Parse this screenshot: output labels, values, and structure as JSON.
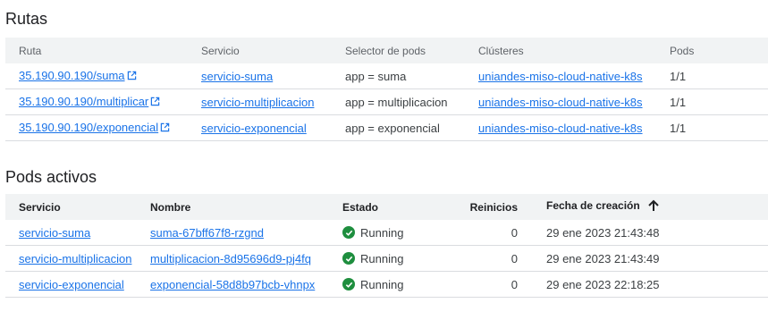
{
  "rutas": {
    "title": "Rutas",
    "headers": [
      "Ruta",
      "Servicio",
      "Selector de pods",
      "Clústeres",
      "Pods"
    ],
    "rows": [
      {
        "ruta": "35.190.90.190/suma",
        "servicio": "servicio-suma",
        "selector": "app = suma",
        "cluster": "uniandes-miso-cloud-native-k8s",
        "pods": "1/1"
      },
      {
        "ruta": "35.190.90.190/multiplicar",
        "servicio": "servicio-multiplicacion",
        "selector": "app = multiplicacion",
        "cluster": "uniandes-miso-cloud-native-k8s",
        "pods": "1/1"
      },
      {
        "ruta": "35.190.90.190/exponencial",
        "servicio": "servicio-exponencial",
        "selector": "app = exponencial",
        "cluster": "uniandes-miso-cloud-native-k8s",
        "pods": "1/1"
      }
    ]
  },
  "pods": {
    "title": "Pods activos",
    "headers": [
      "Servicio",
      "Nombre",
      "Estado",
      "Reinicios",
      "Fecha de creación"
    ],
    "sort_icon": "arrow-upward-icon",
    "rows": [
      {
        "servicio": "servicio-suma",
        "nombre": "suma-67bff67f8-rzgnd",
        "estado": "Running",
        "reinicios": "0",
        "fecha": "29 ene 2023 21:43:48"
      },
      {
        "servicio": "servicio-multiplicacion",
        "nombre": "multiplicacion-8d95696d9-pj4fq",
        "estado": "Running",
        "reinicios": "0",
        "fecha": "29 ene 2023 21:43:49"
      },
      {
        "servicio": "servicio-exponencial",
        "nombre": "exponencial-58d8b97bcb-vhnpx",
        "estado": "Running",
        "reinicios": "0",
        "fecha": "29 ene 2023 22:18:25"
      }
    ]
  },
  "colors": {
    "link": "#1a73e8",
    "status_ok": "#1e8e3e",
    "header_bg": "#f1f3f4"
  }
}
